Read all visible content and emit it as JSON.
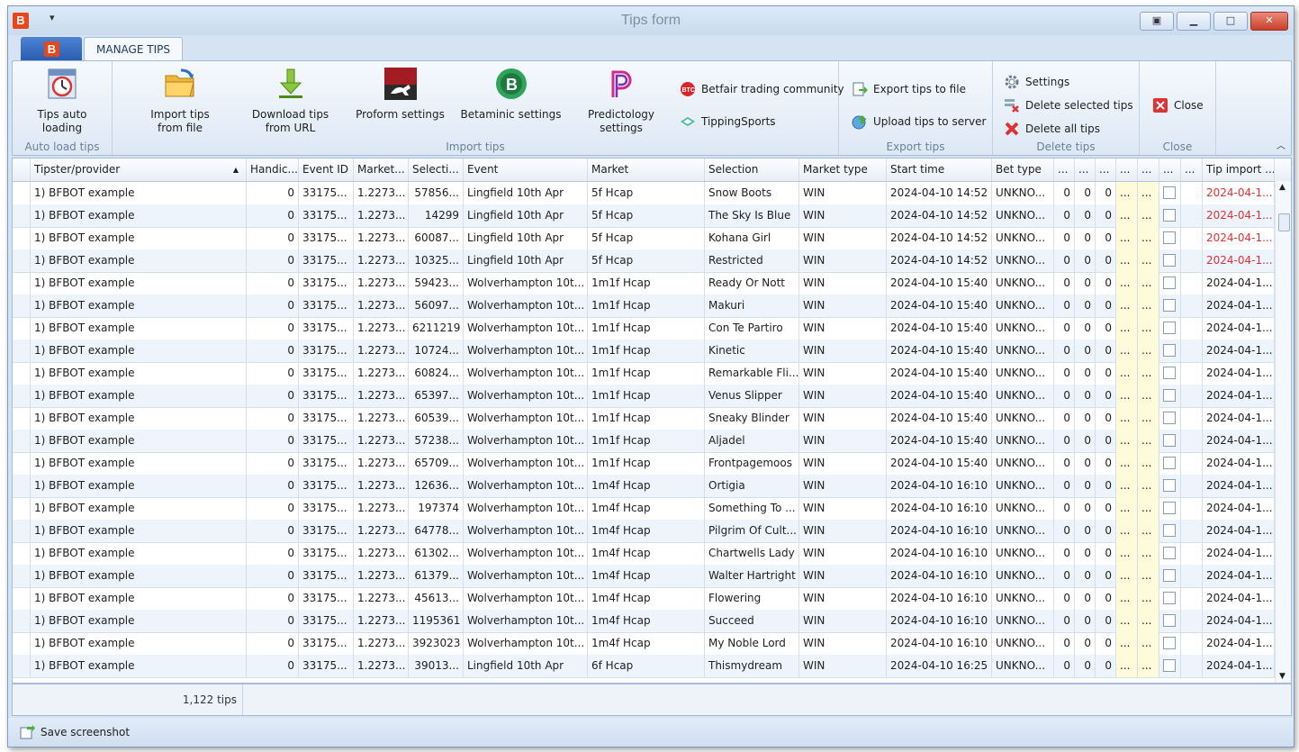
{
  "window": {
    "title": "Tips form",
    "app_letter": "B",
    "qat": "▾"
  },
  "tabs": {
    "active": "MANAGE TIPS"
  },
  "ribbon": {
    "auto_load": {
      "button": [
        "Tips auto",
        "loading"
      ],
      "group": "Auto load tips"
    },
    "import": {
      "import_file": [
        "Import tips",
        "from file"
      ],
      "download_url": [
        "Download tips",
        "from URL"
      ],
      "proform": "Proform settings",
      "betaminic": "Betaminic settings",
      "predictology": [
        "Predictology",
        "settings"
      ],
      "betfair_community": "Betfair trading community",
      "tipping_sports": "TippingSports",
      "group": "Import tips"
    },
    "export": {
      "export_file": "Export tips to file",
      "upload_server": "Upload tips to server",
      "group": "Export tips"
    },
    "delete": {
      "settings": "Settings",
      "delete_selected": "Delete selected tips",
      "delete_all": "Delete all tips",
      "group": "Delete tips"
    },
    "close": {
      "button": "Close",
      "group": "Close"
    },
    "colors": {
      "accent": "#e8461b",
      "ribbon": "#dde8f5"
    }
  },
  "grid": {
    "columns": [
      "Tipster/provider",
      "Handic...",
      "Event ID",
      "Market...",
      "Selecti...",
      "Event",
      "Market",
      "Selection",
      "Market type",
      "Start time",
      "Bet type",
      "...",
      "...",
      "...",
      "...",
      "...",
      "...",
      "...",
      "Tip import ..."
    ],
    "rows": [
      [
        "1) BFBOT example",
        "0",
        "33175...",
        "1.2273...",
        "57856...",
        "Lingfield 10th Apr",
        "5f Hcap",
        "Snow Boots",
        "WIN",
        "2024-04-10 14:52",
        "UNKNO...",
        "0",
        "0",
        "0",
        "...",
        "...",
        "",
        "",
        "2024-04-1..."
      ],
      [
        "1) BFBOT example",
        "0",
        "33175...",
        "1.2273...",
        "14299",
        "Lingfield 10th Apr",
        "5f Hcap",
        "The Sky Is Blue",
        "WIN",
        "2024-04-10 14:52",
        "UNKNO...",
        "0",
        "0",
        "0",
        "...",
        "...",
        "",
        "",
        "2024-04-1..."
      ],
      [
        "1) BFBOT example",
        "0",
        "33175...",
        "1.2273...",
        "60087...",
        "Lingfield 10th Apr",
        "5f Hcap",
        "Kohana Girl",
        "WIN",
        "2024-04-10 14:52",
        "UNKNO...",
        "0",
        "0",
        "0",
        "...",
        "...",
        "",
        "",
        "2024-04-1..."
      ],
      [
        "1) BFBOT example",
        "0",
        "33175...",
        "1.2273...",
        "10325...",
        "Lingfield 10th Apr",
        "5f Hcap",
        "Restricted",
        "WIN",
        "2024-04-10 14:52",
        "UNKNO...",
        "0",
        "0",
        "0",
        "...",
        "...",
        "",
        "",
        "2024-04-1..."
      ],
      [
        "1) BFBOT example",
        "0",
        "33175...",
        "1.2273...",
        "59423...",
        "Wolverhampton 10t...",
        "1m1f Hcap",
        "Ready Or Nott",
        "WIN",
        "2024-04-10 15:40",
        "UNKNO...",
        "0",
        "0",
        "0",
        "...",
        "...",
        "",
        "",
        "2024-04-1..."
      ],
      [
        "1) BFBOT example",
        "0",
        "33175...",
        "1.2273...",
        "56097...",
        "Wolverhampton 10t...",
        "1m1f Hcap",
        "Makuri",
        "WIN",
        "2024-04-10 15:40",
        "UNKNO...",
        "0",
        "0",
        "0",
        "...",
        "...",
        "",
        "",
        "2024-04-1..."
      ],
      [
        "1) BFBOT example",
        "0",
        "33175...",
        "1.2273...",
        "6211219",
        "Wolverhampton 10t...",
        "1m1f Hcap",
        "Con Te Partiro",
        "WIN",
        "2024-04-10 15:40",
        "UNKNO...",
        "0",
        "0",
        "0",
        "...",
        "...",
        "",
        "",
        "2024-04-1..."
      ],
      [
        "1) BFBOT example",
        "0",
        "33175...",
        "1.2273...",
        "10724...",
        "Wolverhampton 10t...",
        "1m1f Hcap",
        "Kinetic",
        "WIN",
        "2024-04-10 15:40",
        "UNKNO...",
        "0",
        "0",
        "0",
        "...",
        "...",
        "",
        "",
        "2024-04-1..."
      ],
      [
        "1) BFBOT example",
        "0",
        "33175...",
        "1.2273...",
        "60824...",
        "Wolverhampton 10t...",
        "1m1f Hcap",
        "Remarkable Fli...",
        "WIN",
        "2024-04-10 15:40",
        "UNKNO...",
        "0",
        "0",
        "0",
        "...",
        "...",
        "",
        "",
        "2024-04-1..."
      ],
      [
        "1) BFBOT example",
        "0",
        "33175...",
        "1.2273...",
        "65397...",
        "Wolverhampton 10t...",
        "1m1f Hcap",
        "Venus Slipper",
        "WIN",
        "2024-04-10 15:40",
        "UNKNO...",
        "0",
        "0",
        "0",
        "...",
        "...",
        "",
        "",
        "2024-04-1..."
      ],
      [
        "1) BFBOT example",
        "0",
        "33175...",
        "1.2273...",
        "60539...",
        "Wolverhampton 10t...",
        "1m1f Hcap",
        "Sneaky Blinder",
        "WIN",
        "2024-04-10 15:40",
        "UNKNO...",
        "0",
        "0",
        "0",
        "...",
        "...",
        "",
        "",
        "2024-04-1..."
      ],
      [
        "1) BFBOT example",
        "0",
        "33175...",
        "1.2273...",
        "57238...",
        "Wolverhampton 10t...",
        "1m1f Hcap",
        "Aljadel",
        "WIN",
        "2024-04-10 15:40",
        "UNKNO...",
        "0",
        "0",
        "0",
        "...",
        "...",
        "",
        "",
        "2024-04-1..."
      ],
      [
        "1) BFBOT example",
        "0",
        "33175...",
        "1.2273...",
        "65709...",
        "Wolverhampton 10t...",
        "1m1f Hcap",
        "Frontpagemoos",
        "WIN",
        "2024-04-10 15:40",
        "UNKNO...",
        "0",
        "0",
        "0",
        "...",
        "...",
        "",
        "",
        "2024-04-1..."
      ],
      [
        "1) BFBOT example",
        "0",
        "33175...",
        "1.2273...",
        "12636...",
        "Wolverhampton 10t...",
        "1m4f Hcap",
        "Ortigia",
        "WIN",
        "2024-04-10 16:10",
        "UNKNO...",
        "0",
        "0",
        "0",
        "...",
        "...",
        "",
        "",
        "2024-04-1..."
      ],
      [
        "1) BFBOT example",
        "0",
        "33175...",
        "1.2273...",
        "197374",
        "Wolverhampton 10t...",
        "1m4f Hcap",
        "Something To ...",
        "WIN",
        "2024-04-10 16:10",
        "UNKNO...",
        "0",
        "0",
        "0",
        "...",
        "...",
        "",
        "",
        "2024-04-1..."
      ],
      [
        "1) BFBOT example",
        "0",
        "33175...",
        "1.2273...",
        "64778...",
        "Wolverhampton 10t...",
        "1m4f Hcap",
        "Pilgrim Of Cult...",
        "WIN",
        "2024-04-10 16:10",
        "UNKNO...",
        "0",
        "0",
        "0",
        "...",
        "...",
        "",
        "",
        "2024-04-1..."
      ],
      [
        "1) BFBOT example",
        "0",
        "33175...",
        "1.2273...",
        "61302...",
        "Wolverhampton 10t...",
        "1m4f Hcap",
        "Chartwells Lady",
        "WIN",
        "2024-04-10 16:10",
        "UNKNO...",
        "0",
        "0",
        "0",
        "...",
        "...",
        "",
        "",
        "2024-04-1..."
      ],
      [
        "1) BFBOT example",
        "0",
        "33175...",
        "1.2273...",
        "61379...",
        "Wolverhampton 10t...",
        "1m4f Hcap",
        "Walter Hartright",
        "WIN",
        "2024-04-10 16:10",
        "UNKNO...",
        "0",
        "0",
        "0",
        "...",
        "...",
        "",
        "",
        "2024-04-1..."
      ],
      [
        "1) BFBOT example",
        "0",
        "33175...",
        "1.2273...",
        "45613...",
        "Wolverhampton 10t...",
        "1m4f Hcap",
        "Flowering",
        "WIN",
        "2024-04-10 16:10",
        "UNKNO...",
        "0",
        "0",
        "0",
        "...",
        "...",
        "",
        "",
        "2024-04-1..."
      ],
      [
        "1) BFBOT example",
        "0",
        "33175...",
        "1.2273...",
        "1195361",
        "Wolverhampton 10t...",
        "1m4f Hcap",
        "Succeed",
        "WIN",
        "2024-04-10 16:10",
        "UNKNO...",
        "0",
        "0",
        "0",
        "...",
        "...",
        "",
        "",
        "2024-04-1..."
      ],
      [
        "1) BFBOT example",
        "0",
        "33175...",
        "1.2273...",
        "3923023",
        "Wolverhampton 10t...",
        "1m4f Hcap",
        "My Noble Lord",
        "WIN",
        "2024-04-10 16:10",
        "UNKNO...",
        "0",
        "0",
        "0",
        "...",
        "...",
        "",
        "",
        "2024-04-1..."
      ],
      [
        "1) BFBOT example",
        "0",
        "33175...",
        "1.2273...",
        "39013...",
        "Lingfield 10th Apr",
        "6f Hcap",
        "Thismydream",
        "WIN",
        "2024-04-10 16:25",
        "UNKNO...",
        "0",
        "0",
        "0",
        "...",
        "...",
        "",
        "",
        "2024-04-1..."
      ]
    ],
    "red_rows": [
      0,
      1,
      2,
      3
    ],
    "footer_count": "1,122 tips"
  },
  "statusbar": {
    "save_screenshot": "Save screenshot"
  }
}
